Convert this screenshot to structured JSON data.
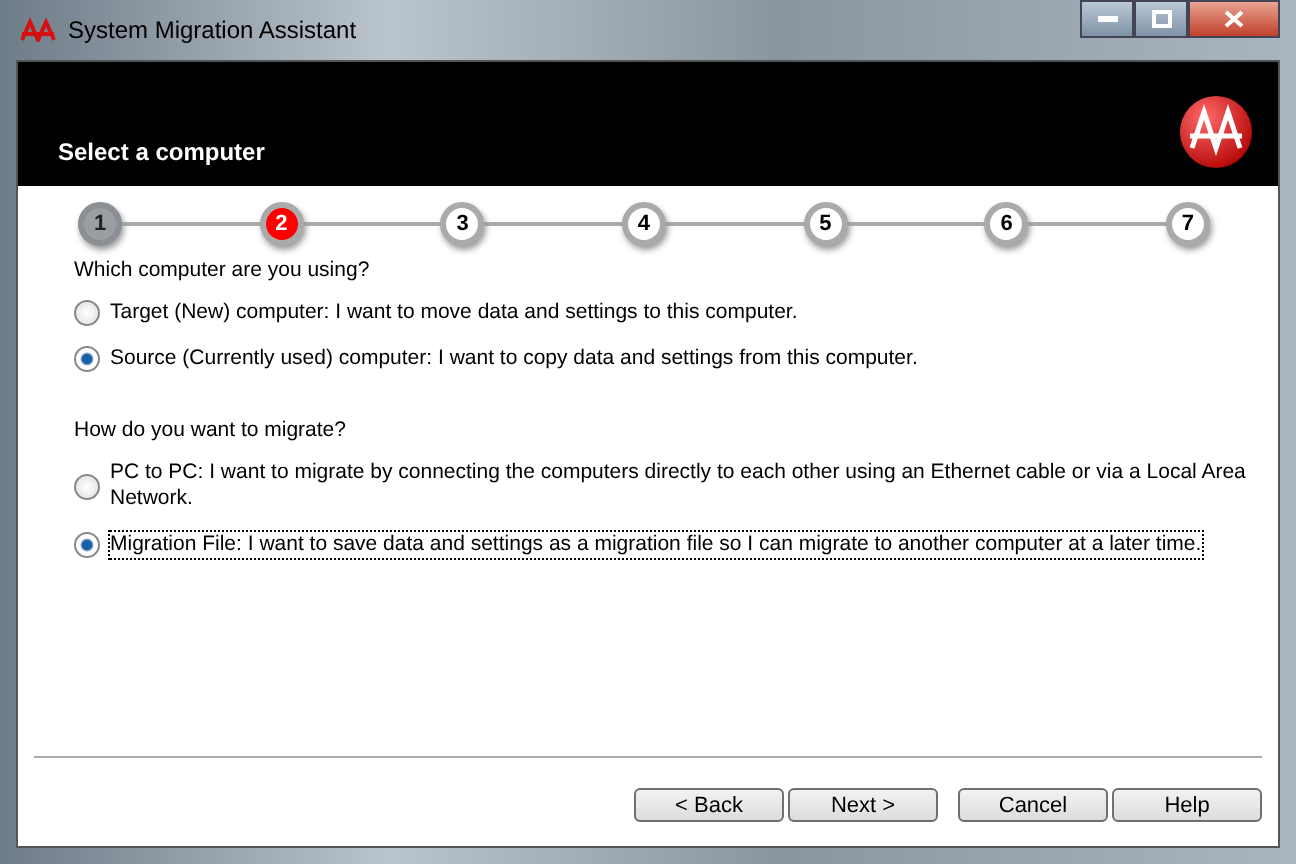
{
  "window": {
    "title": "System Migration Assistant"
  },
  "header": {
    "title": "Select a computer"
  },
  "steps": [
    {
      "label": "1",
      "completed": true,
      "current": false
    },
    {
      "label": "2",
      "completed": false,
      "current": true
    },
    {
      "label": "3",
      "completed": false,
      "current": false
    },
    {
      "label": "4",
      "completed": false,
      "current": false
    },
    {
      "label": "5",
      "completed": false,
      "current": false
    },
    {
      "label": "6",
      "completed": false,
      "current": false
    },
    {
      "label": "7",
      "completed": false,
      "current": false
    }
  ],
  "groups": [
    {
      "question": "Which computer are you using?",
      "options": [
        {
          "label": "Target (New) computer:  I want to move data and settings to this computer.",
          "selected": false,
          "focused": false
        },
        {
          "label": "Source (Currently used) computer:  I want to copy data and settings from this computer.",
          "selected": true,
          "focused": false
        }
      ]
    },
    {
      "question": "How do you want to migrate?",
      "options": [
        {
          "label": "PC to PC: I want to migrate by connecting the computers directly to each other using an Ethernet cable or via a Local Area Network.",
          "selected": false,
          "focused": false
        },
        {
          "label": "Migration File: I want to save data and settings as a migration file so I can migrate to another computer at a later time.",
          "selected": true,
          "focused": true
        }
      ]
    }
  ],
  "buttons": [
    "< Back",
    "Next >",
    "Cancel",
    "Help"
  ]
}
